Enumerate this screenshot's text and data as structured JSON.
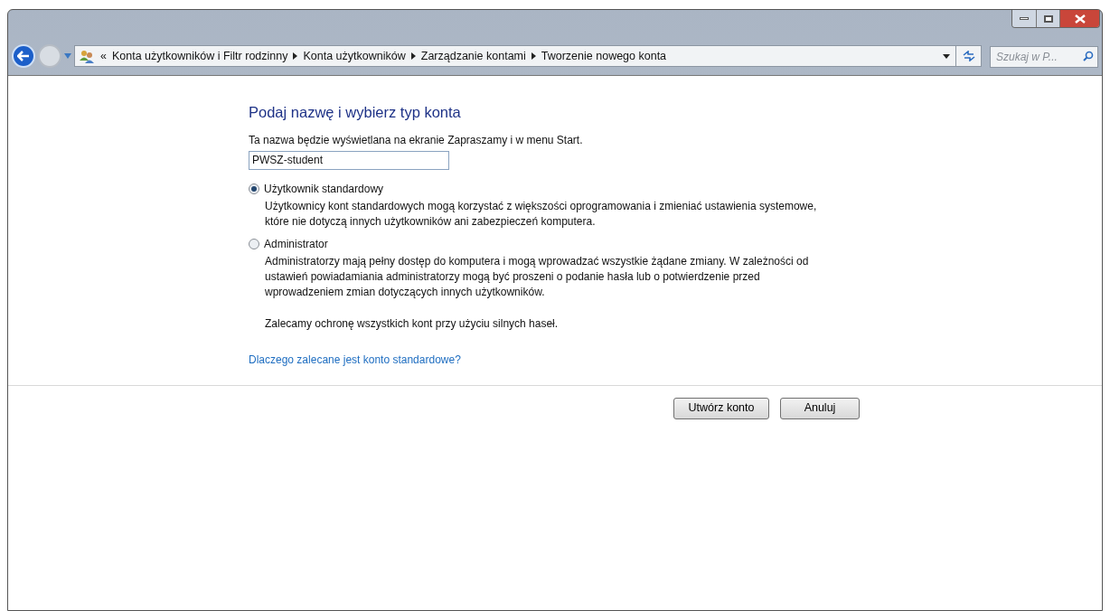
{
  "breadcrumb": {
    "overflow": "«",
    "items": [
      "Konta użytkowników i Filtr rodzinny",
      "Konta użytkowników",
      "Zarządzanie kontami",
      "Tworzenie nowego konta"
    ]
  },
  "search": {
    "placeholder": "Szukaj w P..."
  },
  "heading": "Podaj nazwę i wybierz typ konta",
  "name_prompt": "Ta nazwa będzie wyświetlana na ekranie Zapraszamy i w menu Start.",
  "name_field": {
    "value": "PWSZ-student"
  },
  "account_types": [
    {
      "label": "Użytkownik standardowy",
      "selected": true,
      "description": "Użytkownicy kont standardowych mogą korzystać z większości oprogramowania i zmieniać ustawienia systemowe, które nie dotyczą innych użytkowników ani zabezpieczeń komputera."
    },
    {
      "label": "Administrator",
      "selected": false,
      "description": "Administratorzy mają pełny dostęp do komputera i mogą wprowadzać wszystkie żądane zmiany. W zależności od ustawień powiadamiania administratorzy mogą być proszeni o podanie hasła lub o potwierdzenie przed wprowadzeniem zmian dotyczących innych użytkowników."
    }
  ],
  "recommendation": "Zalecamy ochronę wszystkich kont przy użyciu silnych haseł.",
  "help_link": "Dlaczego zalecane jest konto standardowe?",
  "buttons": [
    "Utwórz konto",
    "Anuluj"
  ]
}
